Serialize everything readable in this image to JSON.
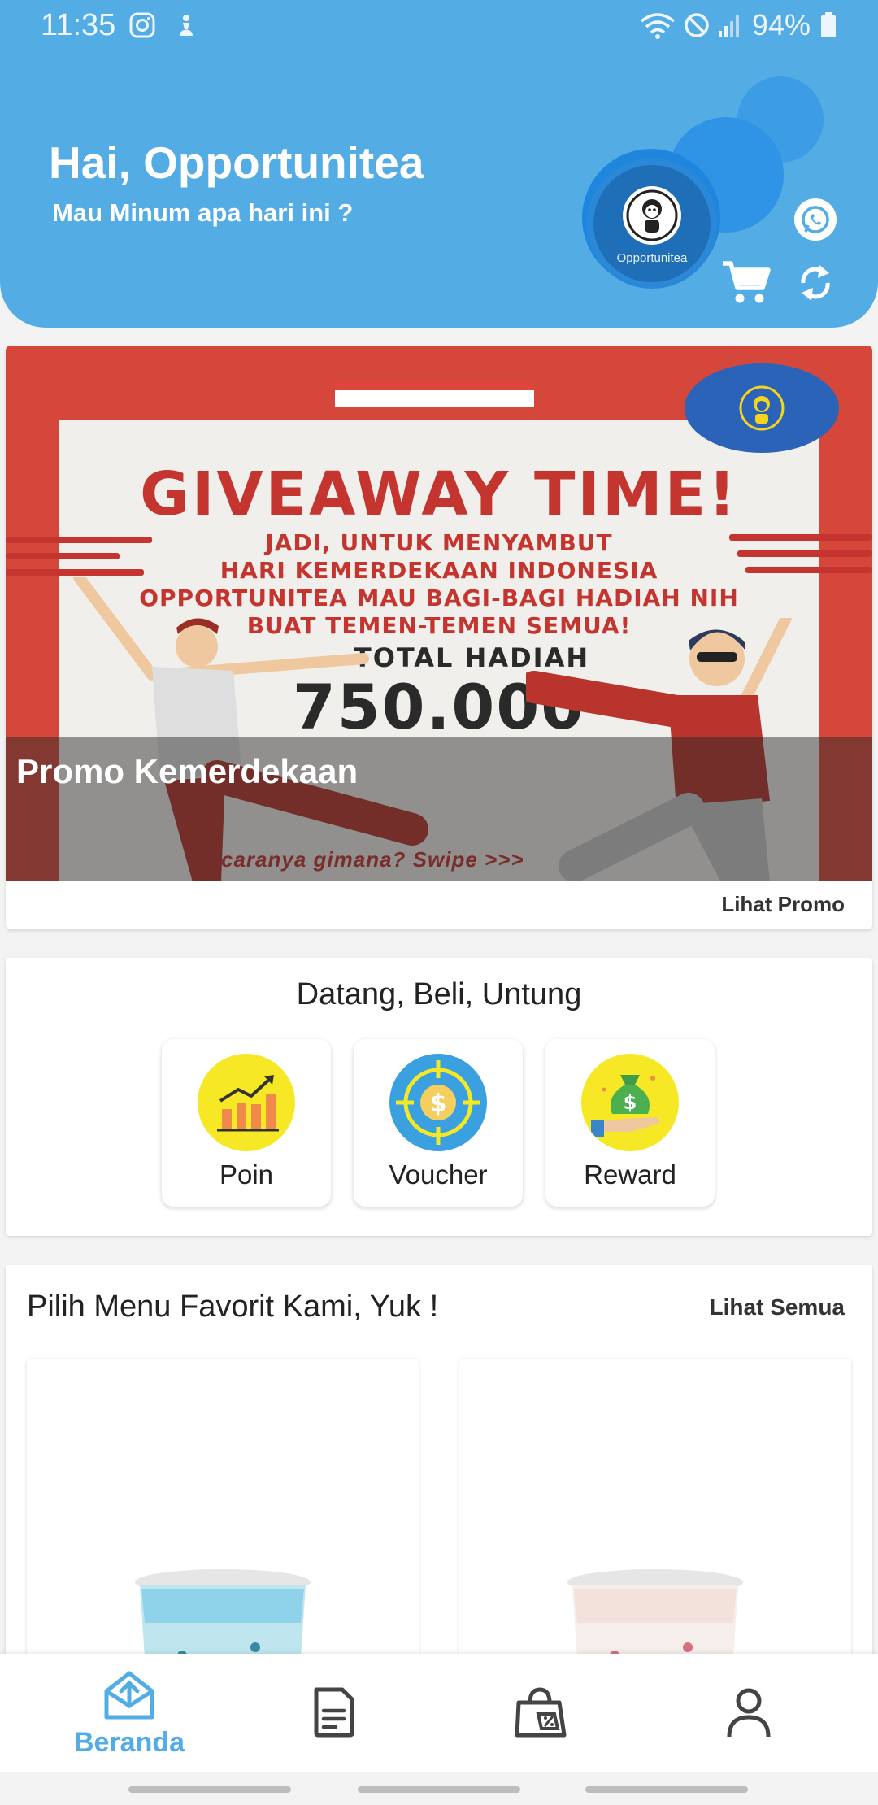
{
  "status_bar": {
    "time": "11:35",
    "battery": "94%"
  },
  "header": {
    "greeting": "Hai, Opportunitea",
    "subtitle": "Mau Minum apa hari ini ?",
    "logo_text": "Opportunitea",
    "colors": {
      "primary": "#54ace5",
      "accent_bubble": "#1f86de"
    }
  },
  "promo": {
    "title": "Promo Kemerdekaan",
    "link": "Lihat Promo",
    "banner": {
      "headline": "GIVEAWAY TIME!",
      "lines": [
        "JADI, UNTUK MENYAMBUT",
        "HARI KEMERDEKAAN INDONESIA",
        "OPPORTUNITEA MAU BAGI-BAGI HADIAH NIH",
        "BUAT TEMEN-TEMEN SEMUA!"
      ],
      "total_label": "TOTAL HADIAH",
      "total_amount": "750.000",
      "swipe_text": "caranya gimana? Swipe >>>"
    }
  },
  "features": {
    "title": "Datang, Beli, Untung",
    "items": [
      {
        "label": "Poin",
        "icon": "chart-growth-icon"
      },
      {
        "label": "Voucher",
        "icon": "dollar-coin-target-icon"
      },
      {
        "label": "Reward",
        "icon": "money-bag-hand-icon"
      }
    ]
  },
  "menu": {
    "title": "Pilih Menu Favorit Kami, Yuk !",
    "see_all": "Lihat Semua"
  },
  "bottom_nav": {
    "items": [
      {
        "label": "Beranda",
        "icon": "home-icon",
        "active": true
      },
      {
        "label": "",
        "icon": "document-icon",
        "active": false
      },
      {
        "label": "",
        "icon": "promo-bag-icon",
        "active": false
      },
      {
        "label": "",
        "icon": "profile-icon",
        "active": false
      }
    ]
  }
}
